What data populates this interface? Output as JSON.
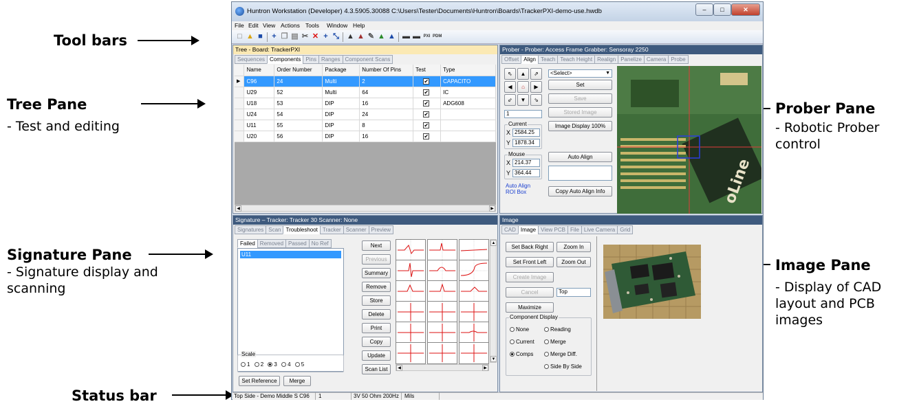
{
  "annotations": {
    "toolbars": "Tool bars",
    "tree_title": "Tree Pane",
    "tree_sub": "- Test and editing",
    "prober_title": "Prober Pane",
    "prober_sub": "- Robotic Prober control",
    "signature_title": "Signature Pane",
    "signature_sub": "- Signature display and scanning",
    "image_title": "Image Pane",
    "image_sub": "- Display of CAD layout and PCB images",
    "status_title": "Status bar"
  },
  "window": {
    "title": "Huntron Workstation (Developer) 4.3.5905.30088  C:\\Users\\Tester\\Documents\\Huntron\\Boards\\TrackerPXI-demo-use.hwdb"
  },
  "menu": [
    "File",
    "Edit",
    "View",
    "Actions",
    "Tools",
    "Window",
    "Help"
  ],
  "tree": {
    "title": "Tree - Board: TrackerPXI",
    "tabs": [
      "Sequences",
      "Components",
      "Pins",
      "Ranges",
      "Component Scans"
    ],
    "active_tab": "Components",
    "columns": [
      "Name",
      "Order Number",
      "Package",
      "Number Of Pins",
      "Test",
      "Type"
    ],
    "rows": [
      {
        "name": "C96",
        "order": "24",
        "package": "Multi",
        "pins": "2",
        "test": "✔",
        "type": "CAPACITO"
      },
      {
        "name": "U29",
        "order": "52",
        "package": "Multi",
        "pins": "64",
        "test": "✔",
        "type": "IC"
      },
      {
        "name": "U18",
        "order": "53",
        "package": "DIP",
        "pins": "16",
        "test": "✔",
        "type": "ADG608"
      },
      {
        "name": "U24",
        "order": "54",
        "package": "DIP",
        "pins": "24",
        "test": "✔",
        "type": ""
      },
      {
        "name": "U11",
        "order": "55",
        "package": "DIP",
        "pins": "8",
        "test": "✔",
        "type": ""
      },
      {
        "name": "U20",
        "order": "56",
        "package": "DIP",
        "pins": "16",
        "test": "✔",
        "type": ""
      }
    ]
  },
  "prober": {
    "title": "Prober - Prober: Access Frame Grabber: Sensoray 2250",
    "tabs": [
      "Offset",
      "Align",
      "Teach",
      "Teach Height",
      "Realign",
      "Panelize",
      "Camera",
      "Probe"
    ],
    "active_tab": "Align",
    "select_value": "<Select>",
    "set": "Set",
    "save": "Save",
    "stored_image": "Stored Image",
    "image_display": "Image Display 100%",
    "step_value": "1",
    "current_label": "Current",
    "current_x": "2584.25",
    "current_y": "1878.34",
    "mouse_label": "Mouse",
    "mouse_x": "214.37",
    "mouse_y": "364.44",
    "x_label": "X",
    "y_label": "Y",
    "auto_align": "Auto Align",
    "copy_auto_align": "Copy Auto Align Info",
    "roi_label": "Auto Align ROI Box"
  },
  "signature": {
    "title": "Signature – Tracker: Tracker 30  Scanner: None",
    "tabs": [
      "Signatures",
      "Scan",
      "Troubleshoot",
      "Tracker",
      "Scanner",
      "Preview"
    ],
    "active_tab": "Troubleshoot",
    "subtabs": [
      "Failed",
      "Removed",
      "Passed",
      "No Ref"
    ],
    "active_subtab": "Failed",
    "list_item": "U11",
    "buttons": [
      "Next",
      "Previous",
      "Summary",
      "Remove",
      "Store",
      "Delete",
      "Print",
      "Copy",
      "Update",
      "Scan List"
    ],
    "scale_label": "Scale",
    "scale_options": [
      "1",
      "2",
      "3",
      "4",
      "5"
    ],
    "scale_selected": "3",
    "set_reference": "Set Reference",
    "merge": "Merge"
  },
  "image": {
    "title": "Image",
    "tabs": [
      "CAD",
      "Image",
      "View PCB",
      "File",
      "Live Camera",
      "Grid"
    ],
    "active_tab": "Image",
    "set_back_right": "Set Back Right",
    "zoom_in": "Zoom In",
    "set_front_left": "Set Front Left",
    "zoom_out": "Zoom Out",
    "create_image": "Create Image",
    "cancel": "Cancel",
    "top_field": "Top",
    "maximize": "Maximize",
    "component_display": "Component Display",
    "options": [
      "None",
      "Reading",
      "Current",
      "Merge",
      "Comps",
      "Merge Diff.",
      "Side By Side"
    ],
    "selected": "Comps"
  },
  "status": {
    "side": "Top Side - Demo Middle S  C96",
    "count": "1",
    "range": "3V 50 Ohm 200Hz",
    "units": "Mils"
  }
}
